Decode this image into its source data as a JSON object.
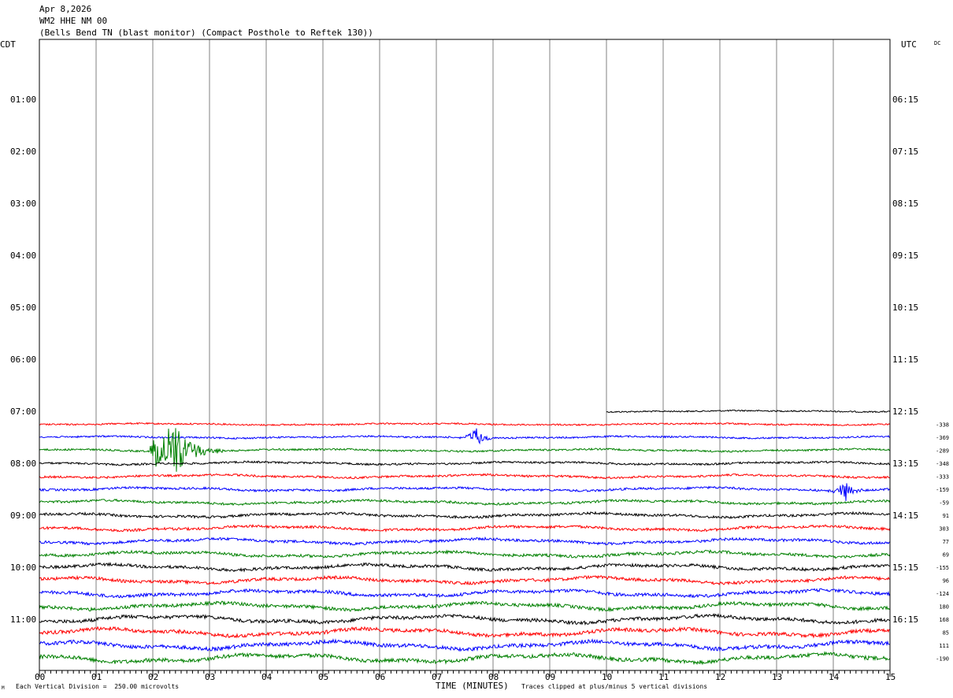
{
  "header": {
    "date": "Apr 8,2026",
    "station": "WM2 HHE NM 00",
    "description": "(Bells Bend TN (blast monitor) (Compact Posthole to Reftek 130))"
  },
  "left_timezone": "CDT",
  "right_timezone": "UTC",
  "dc_label": "DC",
  "footer": {
    "left_note": "Each Vertical Division =  250.00 microvolts",
    "x_axis_title": "TIME (MINUTES)",
    "right_note": "Traces clipped at plus/minus 5 vertical divisions",
    "corner_mark": "M"
  },
  "chart_data": {
    "type": "line",
    "title": "",
    "xlabel": "TIME (MINUTES)",
    "xlim": [
      0,
      15
    ],
    "x_ticks": [
      "00",
      "01",
      "02",
      "03",
      "04",
      "05",
      "06",
      "07",
      "08",
      "09",
      "10",
      "11",
      "12",
      "13",
      "14",
      "15"
    ],
    "row_minutes": 15,
    "left_hour_labels": [
      "01:00",
      "02:00",
      "03:00",
      "04:00",
      "05:00",
      "06:00",
      "07:00",
      "08:00",
      "09:00",
      "10:00",
      "11:00"
    ],
    "right_hour_labels": [
      "06:15",
      "07:15",
      "08:15",
      "09:15",
      "10:15",
      "11:15",
      "12:15",
      "13:15",
      "14:15",
      "15:15",
      "16:15"
    ],
    "trace_colors": [
      "#000000",
      "#ff0000",
      "#0000ff",
      "#008000"
    ],
    "traces": [
      {
        "start_cdt": "07:00",
        "start_minute": 10.0,
        "color": "#000000",
        "dc": ""
      },
      {
        "start_cdt": "07:15",
        "start_minute": 0,
        "color": "#ff0000",
        "dc": "-338"
      },
      {
        "start_cdt": "07:30",
        "start_minute": 0,
        "color": "#0000ff",
        "dc": "-369"
      },
      {
        "start_cdt": "07:45",
        "start_minute": 0,
        "color": "#008000",
        "dc": "-289"
      },
      {
        "start_cdt": "08:00",
        "start_minute": 0,
        "color": "#000000",
        "dc": "-348"
      },
      {
        "start_cdt": "08:15",
        "start_minute": 0,
        "color": "#ff0000",
        "dc": "-333"
      },
      {
        "start_cdt": "08:30",
        "start_minute": 0,
        "color": "#0000ff",
        "dc": "-159"
      },
      {
        "start_cdt": "08:45",
        "start_minute": 0,
        "color": "#008000",
        "dc": "-59"
      },
      {
        "start_cdt": "09:00",
        "start_minute": 0,
        "color": "#000000",
        "dc": "91"
      },
      {
        "start_cdt": "09:15",
        "start_minute": 0,
        "color": "#ff0000",
        "dc": "303"
      },
      {
        "start_cdt": "09:30",
        "start_minute": 0,
        "color": "#0000ff",
        "dc": "77"
      },
      {
        "start_cdt": "09:45",
        "start_minute": 0,
        "color": "#008000",
        "dc": "69"
      },
      {
        "start_cdt": "10:00",
        "start_minute": 0,
        "color": "#000000",
        "dc": "-155"
      },
      {
        "start_cdt": "10:15",
        "start_minute": 0,
        "color": "#ff0000",
        "dc": "96"
      },
      {
        "start_cdt": "10:30",
        "start_minute": 0,
        "color": "#0000ff",
        "dc": "-124"
      },
      {
        "start_cdt": "10:45",
        "start_minute": 0,
        "color": "#008000",
        "dc": "180"
      },
      {
        "start_cdt": "11:00",
        "start_minute": 0,
        "color": "#000000",
        "dc": "168"
      },
      {
        "start_cdt": "11:15",
        "start_minute": 0,
        "color": "#ff0000",
        "dc": "85"
      },
      {
        "start_cdt": "11:30",
        "start_minute": 0,
        "color": "#0000ff",
        "dc": "111"
      },
      {
        "start_cdt": "11:45",
        "start_minute": 0,
        "color": "#008000",
        "dc": "-190"
      }
    ],
    "events": [
      {
        "start_cdt": "07:45",
        "minute": 2.3,
        "color": "#008000",
        "note": "large local event"
      },
      {
        "start_cdt": "07:30",
        "minute": 7.7,
        "color": "#0000ff",
        "note": "small burst"
      },
      {
        "start_cdt": "08:30",
        "minute": 14.2,
        "color": "#0000ff",
        "note": "small burst"
      }
    ]
  }
}
